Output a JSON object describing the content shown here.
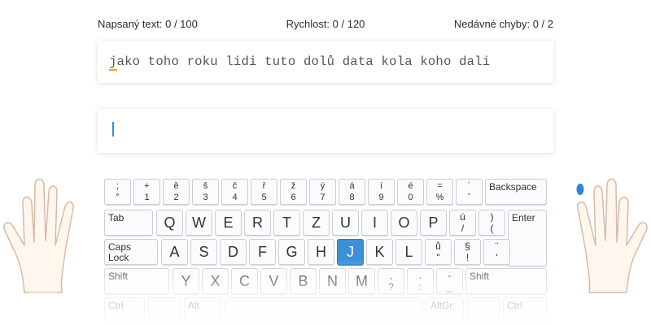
{
  "stats": {
    "typed": "Napsaný text: 0 / 100",
    "speed": "Rychlost: 0 / 120",
    "errors": "Nedávné chyby: 0 / 2"
  },
  "target": {
    "current_char": "j",
    "rest": "ako toho roku lidi tuto dolů data kola koho dali"
  },
  "input": {
    "value": ""
  },
  "keyboard": {
    "active_key": "J",
    "accent_color": "#3d8fd8",
    "caret_color": "#3a8ad6",
    "highlight_color": "#f0a030",
    "number_row": [
      {
        "top": ";",
        "bottom": "°"
      },
      {
        "top": "+",
        "bottom": "1"
      },
      {
        "top": "ě",
        "bottom": "2"
      },
      {
        "top": "š",
        "bottom": "3"
      },
      {
        "top": "č",
        "bottom": "4"
      },
      {
        "top": "ř",
        "bottom": "5"
      },
      {
        "top": "ž",
        "bottom": "6"
      },
      {
        "top": "ý",
        "bottom": "7"
      },
      {
        "top": "á",
        "bottom": "8"
      },
      {
        "top": "í",
        "bottom": "9"
      },
      {
        "top": "é",
        "bottom": "0"
      },
      {
        "top": "=",
        "bottom": "%"
      },
      {
        "top": "´",
        "bottom": "ˇ"
      }
    ],
    "backspace": "Backspace",
    "tab": "Tab",
    "enter": "Enter",
    "caps": "Caps Lock",
    "shift_left": "Shift",
    "shift_right": "Shift",
    "ctrl_left": "Ctrl",
    "alt_left": "Alt",
    "altgr": "AltGr",
    "ctrl_right": "Ctrl",
    "row_q": [
      "Q",
      "W",
      "E",
      "R",
      "T",
      "Z",
      "U",
      "I",
      "O",
      "P"
    ],
    "row_q_extra": [
      {
        "top": "ú",
        "bottom": "/"
      },
      {
        "top": ")",
        "bottom": "("
      }
    ],
    "row_a": [
      "A",
      "S",
      "D",
      "F",
      "G",
      "H",
      "J",
      "K",
      "L"
    ],
    "row_a_extra": [
      {
        "top": "ů",
        "bottom": "\""
      },
      {
        "top": "§",
        "bottom": "!"
      },
      {
        "top": "¨",
        "bottom": "'"
      }
    ],
    "row_y": [
      "Y",
      "X",
      "C",
      "V",
      "B",
      "N",
      "M"
    ],
    "row_y_extra": [
      {
        "top": ",",
        "bottom": "?"
      },
      {
        "top": ".",
        "bottom": ":"
      },
      {
        "top": "-",
        "bottom": "_"
      }
    ]
  },
  "hands": {
    "right_highlight_finger": "index",
    "highlight_color": "#3d8fd8"
  }
}
